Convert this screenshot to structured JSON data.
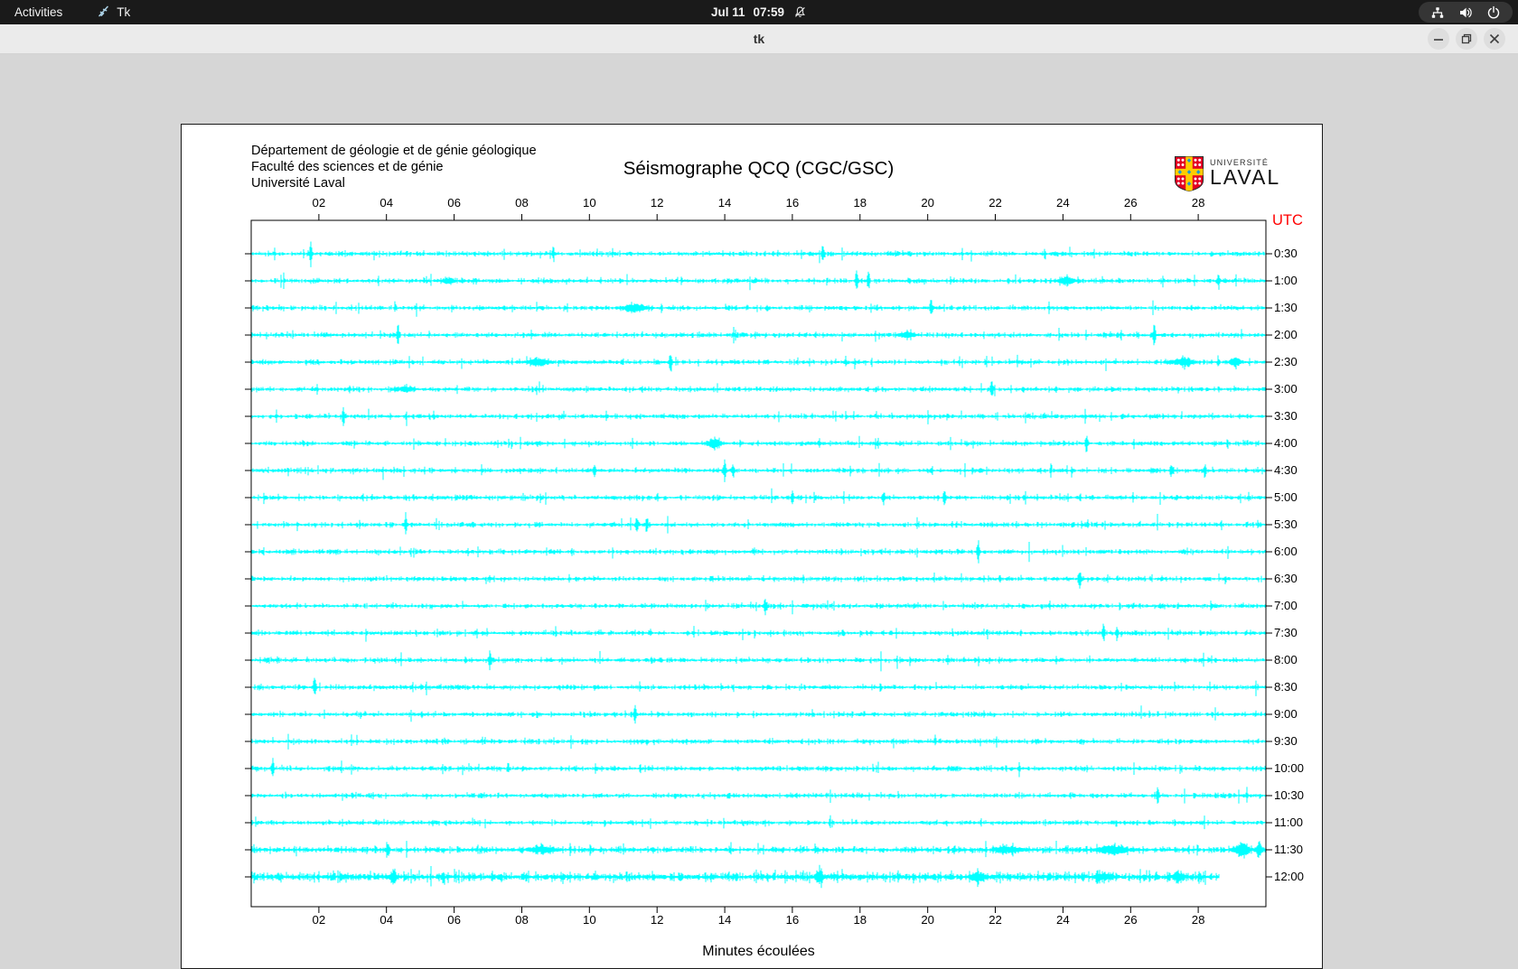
{
  "topbar": {
    "activities_label": "Activities",
    "app_name": "Tk",
    "clock": {
      "date": "Jul 11",
      "time": "07:59"
    }
  },
  "titlebar": {
    "title": "tk"
  },
  "page": {
    "header_lines": [
      "Département de géologie et de génie géologique",
      "Faculté des sciences et de génie",
      "Université Laval"
    ],
    "logo": {
      "line1": "UNIVERSITÉ",
      "line2": "LAVAL"
    }
  },
  "chart_data": {
    "type": "seismogram-helicorder",
    "title": "Séismographe QCQ (CGC/GSC)",
    "xlabel": "Minutes écoulées",
    "utc_label": "UTC",
    "trace_color": "#00ffff",
    "utc_axis_color": "#ff0000",
    "x_axis": {
      "range_minutes": [
        0,
        30
      ],
      "tick_minutes": [
        2,
        4,
        6,
        8,
        10,
        12,
        14,
        16,
        18,
        20,
        22,
        24,
        26,
        28
      ],
      "tick_labels": [
        "02",
        "04",
        "06",
        "08",
        "10",
        "12",
        "14",
        "16",
        "18",
        "20",
        "22",
        "24",
        "26",
        "28"
      ]
    },
    "rows": [
      {
        "label": "0:30",
        "end_minute": 30,
        "noise": 1.0,
        "spikes": [
          [
            1.76,
            12,
            1
          ],
          [
            16.9,
            10,
            1
          ]
        ]
      },
      {
        "label": "1:00",
        "end_minute": 30,
        "noise": 1.0,
        "spikes": [
          [
            5.8,
            3,
            4
          ],
          [
            17.9,
            13,
            1
          ],
          [
            18.25,
            10,
            1
          ],
          [
            24.1,
            4,
            6
          ],
          [
            28.6,
            8,
            1
          ]
        ]
      },
      {
        "label": "1:30",
        "end_minute": 30,
        "noise": 1.0,
        "spikes": [
          [
            11.35,
            4,
            8
          ],
          [
            20.1,
            9,
            1
          ]
        ]
      },
      {
        "label": "2:00",
        "end_minute": 30,
        "noise": 1.0,
        "spikes": [
          [
            4.34,
            12,
            1
          ],
          [
            19.4,
            3,
            6
          ],
          [
            26.7,
            10,
            1
          ]
        ]
      },
      {
        "label": "2:30",
        "end_minute": 30,
        "noise": 1.0,
        "spikes": [
          [
            8.5,
            4,
            7
          ],
          [
            12.4,
            12,
            1
          ],
          [
            27.6,
            4,
            6
          ],
          [
            29.1,
            5,
            4
          ]
        ]
      },
      {
        "label": "3:00",
        "end_minute": 30,
        "noise": 1.0,
        "spikes": [
          [
            4.6,
            3,
            5
          ],
          [
            21.9,
            10,
            1
          ]
        ]
      },
      {
        "label": "3:30",
        "end_minute": 30,
        "noise": 1.0,
        "spikes": [
          [
            2.73,
            11,
            1
          ]
        ]
      },
      {
        "label": "4:00",
        "end_minute": 30,
        "noise": 1.0,
        "spikes": [
          [
            13.7,
            5,
            5
          ],
          [
            24.7,
            10,
            1
          ]
        ]
      },
      {
        "label": "4:30",
        "end_minute": 30,
        "noise": 1.0,
        "spikes": [
          [
            10.15,
            9,
            1
          ],
          [
            14.0,
            12,
            1
          ],
          [
            14.25,
            8,
            1
          ],
          [
            27.2,
            7,
            1
          ],
          [
            28.2,
            8,
            1
          ]
        ]
      },
      {
        "label": "5:00",
        "end_minute": 30,
        "noise": 1.0,
        "spikes": [
          [
            16.0,
            7,
            1
          ],
          [
            18.7,
            7,
            1
          ],
          [
            20.5,
            8,
            1
          ]
        ]
      },
      {
        "label": "5:30",
        "end_minute": 30,
        "noise": 1.0,
        "spikes": [
          [
            4.57,
            10,
            1
          ],
          [
            11.4,
            10,
            1
          ],
          [
            11.7,
            8,
            1
          ]
        ]
      },
      {
        "label": "6:00",
        "end_minute": 30,
        "noise": 1.0,
        "spikes": [
          [
            21.5,
            9,
            1
          ]
        ]
      },
      {
        "label": "6:30",
        "end_minute": 30,
        "noise": 1.0,
        "spikes": [
          [
            24.5,
            10,
            1
          ]
        ]
      },
      {
        "label": "7:00",
        "end_minute": 30,
        "noise": 1.0,
        "spikes": [
          [
            15.2,
            9,
            1
          ]
        ]
      },
      {
        "label": "7:30",
        "end_minute": 30,
        "noise": 1.0,
        "spikes": [
          [
            25.2,
            9,
            1
          ],
          [
            25.6,
            8,
            1
          ]
        ]
      },
      {
        "label": "8:00",
        "end_minute": 30,
        "noise": 1.0,
        "spikes": [
          [
            7.06,
            10,
            1
          ]
        ]
      },
      {
        "label": "8:30",
        "end_minute": 30,
        "noise": 1.0,
        "spikes": [
          [
            1.88,
            10,
            1
          ]
        ]
      },
      {
        "label": "9:00",
        "end_minute": 30,
        "noise": 1.0,
        "spikes": [
          [
            11.35,
            10,
            1
          ]
        ]
      },
      {
        "label": "9:30",
        "end_minute": 30,
        "noise": 1.0,
        "spikes": []
      },
      {
        "label": "10:00",
        "end_minute": 30,
        "noise": 1.0,
        "spikes": [
          [
            0.64,
            11,
            1
          ]
        ]
      },
      {
        "label": "10:30",
        "end_minute": 30,
        "noise": 1.0,
        "spikes": [
          [
            26.8,
            9,
            1
          ]
        ]
      },
      {
        "label": "11:00",
        "end_minute": 30,
        "noise": 1.0,
        "spikes": []
      },
      {
        "label": "11:30",
        "end_minute": 30,
        "noise": 1.3,
        "spikes": [
          [
            4.05,
            9,
            1
          ],
          [
            8.6,
            3,
            10
          ],
          [
            22.4,
            3,
            10
          ],
          [
            25.5,
            4,
            12
          ],
          [
            29.3,
            8,
            5
          ],
          [
            29.8,
            9,
            2
          ]
        ]
      },
      {
        "label": "12:00",
        "end_minute": 28.6,
        "noise": 1.9,
        "spikes": [
          [
            4.2,
            4,
            3
          ],
          [
            16.8,
            5,
            3
          ],
          [
            21.5,
            4,
            5
          ],
          [
            25.2,
            3,
            6
          ],
          [
            27.4,
            4,
            4
          ]
        ]
      }
    ]
  }
}
